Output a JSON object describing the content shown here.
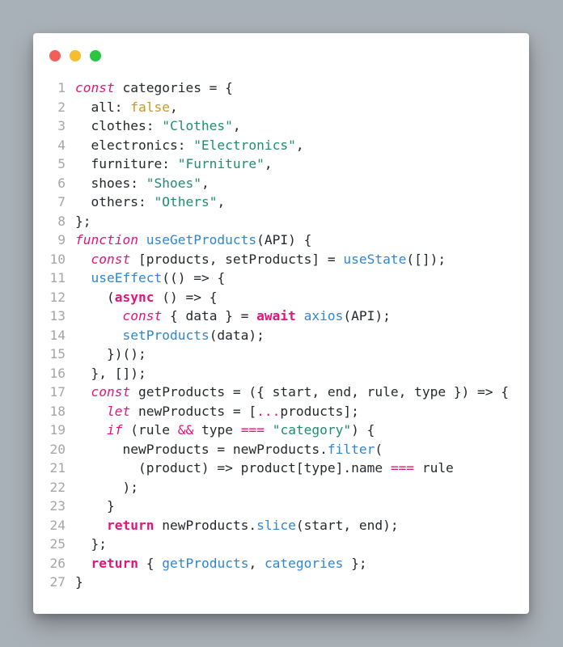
{
  "window": {
    "traffic_lights": [
      {
        "name": "close",
        "color": "#f25f5a"
      },
      {
        "name": "minimize",
        "color": "#f5bd2f"
      },
      {
        "name": "zoom",
        "color": "#27c840"
      }
    ]
  },
  "colors": {
    "keyword": "#e2157a",
    "function": "#2f86d2",
    "string": "#1f8f6f",
    "literal": "#c99a22",
    "text": "#24292e",
    "line_number": "#a6a6a6"
  },
  "editor": {
    "lines": [
      {
        "number": "1",
        "tokens": [
          {
            "t": "const",
            "c": "kw-it"
          },
          {
            "t": " categories = {"
          }
        ]
      },
      {
        "number": "2",
        "tokens": [
          {
            "t": "  all: "
          },
          {
            "t": "false",
            "c": "num"
          },
          {
            "t": ","
          }
        ]
      },
      {
        "number": "3",
        "tokens": [
          {
            "t": "  clothes: "
          },
          {
            "t": "\"Clothes\"",
            "c": "str"
          },
          {
            "t": ","
          }
        ]
      },
      {
        "number": "4",
        "tokens": [
          {
            "t": "  electronics: "
          },
          {
            "t": "\"Electronics\"",
            "c": "str"
          },
          {
            "t": ","
          }
        ]
      },
      {
        "number": "5",
        "tokens": [
          {
            "t": "  furniture: "
          },
          {
            "t": "\"Furniture\"",
            "c": "str"
          },
          {
            "t": ","
          }
        ]
      },
      {
        "number": "6",
        "tokens": [
          {
            "t": "  shoes: "
          },
          {
            "t": "\"Shoes\"",
            "c": "str"
          },
          {
            "t": ","
          }
        ]
      },
      {
        "number": "7",
        "tokens": [
          {
            "t": "  others: "
          },
          {
            "t": "\"Others\"",
            "c": "str"
          },
          {
            "t": ","
          }
        ]
      },
      {
        "number": "8",
        "tokens": [
          {
            "t": "};"
          }
        ]
      },
      {
        "number": "9",
        "tokens": [
          {
            "t": "function",
            "c": "kw-it"
          },
          {
            "t": " "
          },
          {
            "t": "useGetProducts",
            "c": "fn"
          },
          {
            "t": "(API) {"
          }
        ]
      },
      {
        "number": "10",
        "tokens": [
          {
            "t": "  "
          },
          {
            "t": "const",
            "c": "kw-it"
          },
          {
            "t": " [products, setProducts] = "
          },
          {
            "t": "useState",
            "c": "fn"
          },
          {
            "t": "([]);"
          }
        ]
      },
      {
        "number": "11",
        "tokens": [
          {
            "t": "  "
          },
          {
            "t": "useEffect",
            "c": "fn"
          },
          {
            "t": "(() => {"
          }
        ]
      },
      {
        "number": "12",
        "tokens": [
          {
            "t": "    ("
          },
          {
            "t": "async",
            "c": "kw-b"
          },
          {
            "t": " () => {"
          }
        ]
      },
      {
        "number": "13",
        "tokens": [
          {
            "t": "      "
          },
          {
            "t": "const",
            "c": "kw-it"
          },
          {
            "t": " { data } = "
          },
          {
            "t": "await",
            "c": "kw-b"
          },
          {
            "t": " "
          },
          {
            "t": "axios",
            "c": "fn"
          },
          {
            "t": "(API);"
          }
        ]
      },
      {
        "number": "14",
        "tokens": [
          {
            "t": "      "
          },
          {
            "t": "setProducts",
            "c": "fn"
          },
          {
            "t": "(data);"
          }
        ]
      },
      {
        "number": "15",
        "tokens": [
          {
            "t": "    })();"
          }
        ]
      },
      {
        "number": "16",
        "tokens": [
          {
            "t": "  }, []);"
          }
        ]
      },
      {
        "number": "17",
        "tokens": [
          {
            "t": "  "
          },
          {
            "t": "const",
            "c": "kw-it"
          },
          {
            "t": " getProducts = ({ start, end, rule, type }) => {"
          }
        ]
      },
      {
        "number": "18",
        "tokens": [
          {
            "t": "    "
          },
          {
            "t": "let",
            "c": "kw-it"
          },
          {
            "t": " newProducts = ["
          },
          {
            "t": "...",
            "c": "op"
          },
          {
            "t": "products];"
          }
        ]
      },
      {
        "number": "19",
        "tokens": [
          {
            "t": "    "
          },
          {
            "t": "if",
            "c": "kw-it"
          },
          {
            "t": " (rule "
          },
          {
            "t": "&&",
            "c": "op"
          },
          {
            "t": " type "
          },
          {
            "t": "===",
            "c": "op"
          },
          {
            "t": " "
          },
          {
            "t": "\"category\"",
            "c": "str"
          },
          {
            "t": ") {"
          }
        ]
      },
      {
        "number": "20",
        "tokens": [
          {
            "t": "      newProducts = newProducts."
          },
          {
            "t": "filter",
            "c": "fn"
          },
          {
            "t": "("
          }
        ]
      },
      {
        "number": "21",
        "tokens": [
          {
            "t": "        (product) => product[type].name "
          },
          {
            "t": "===",
            "c": "op"
          },
          {
            "t": " rule"
          }
        ]
      },
      {
        "number": "22",
        "tokens": [
          {
            "t": "      );"
          }
        ]
      },
      {
        "number": "23",
        "tokens": [
          {
            "t": "    }"
          }
        ]
      },
      {
        "number": "24",
        "tokens": [
          {
            "t": "    "
          },
          {
            "t": "return",
            "c": "kw-b"
          },
          {
            "t": " newProducts."
          },
          {
            "t": "slice",
            "c": "fn"
          },
          {
            "t": "(start, end);"
          }
        ]
      },
      {
        "number": "25",
        "tokens": [
          {
            "t": "  };"
          }
        ]
      },
      {
        "number": "26",
        "tokens": [
          {
            "t": "  "
          },
          {
            "t": "return",
            "c": "kw-b"
          },
          {
            "t": " { "
          },
          {
            "t": "getProducts",
            "c": "fn"
          },
          {
            "t": ", "
          },
          {
            "t": "categories",
            "c": "fn"
          },
          {
            "t": " };"
          }
        ]
      },
      {
        "number": "27",
        "tokens": [
          {
            "t": "}"
          }
        ]
      }
    ]
  }
}
